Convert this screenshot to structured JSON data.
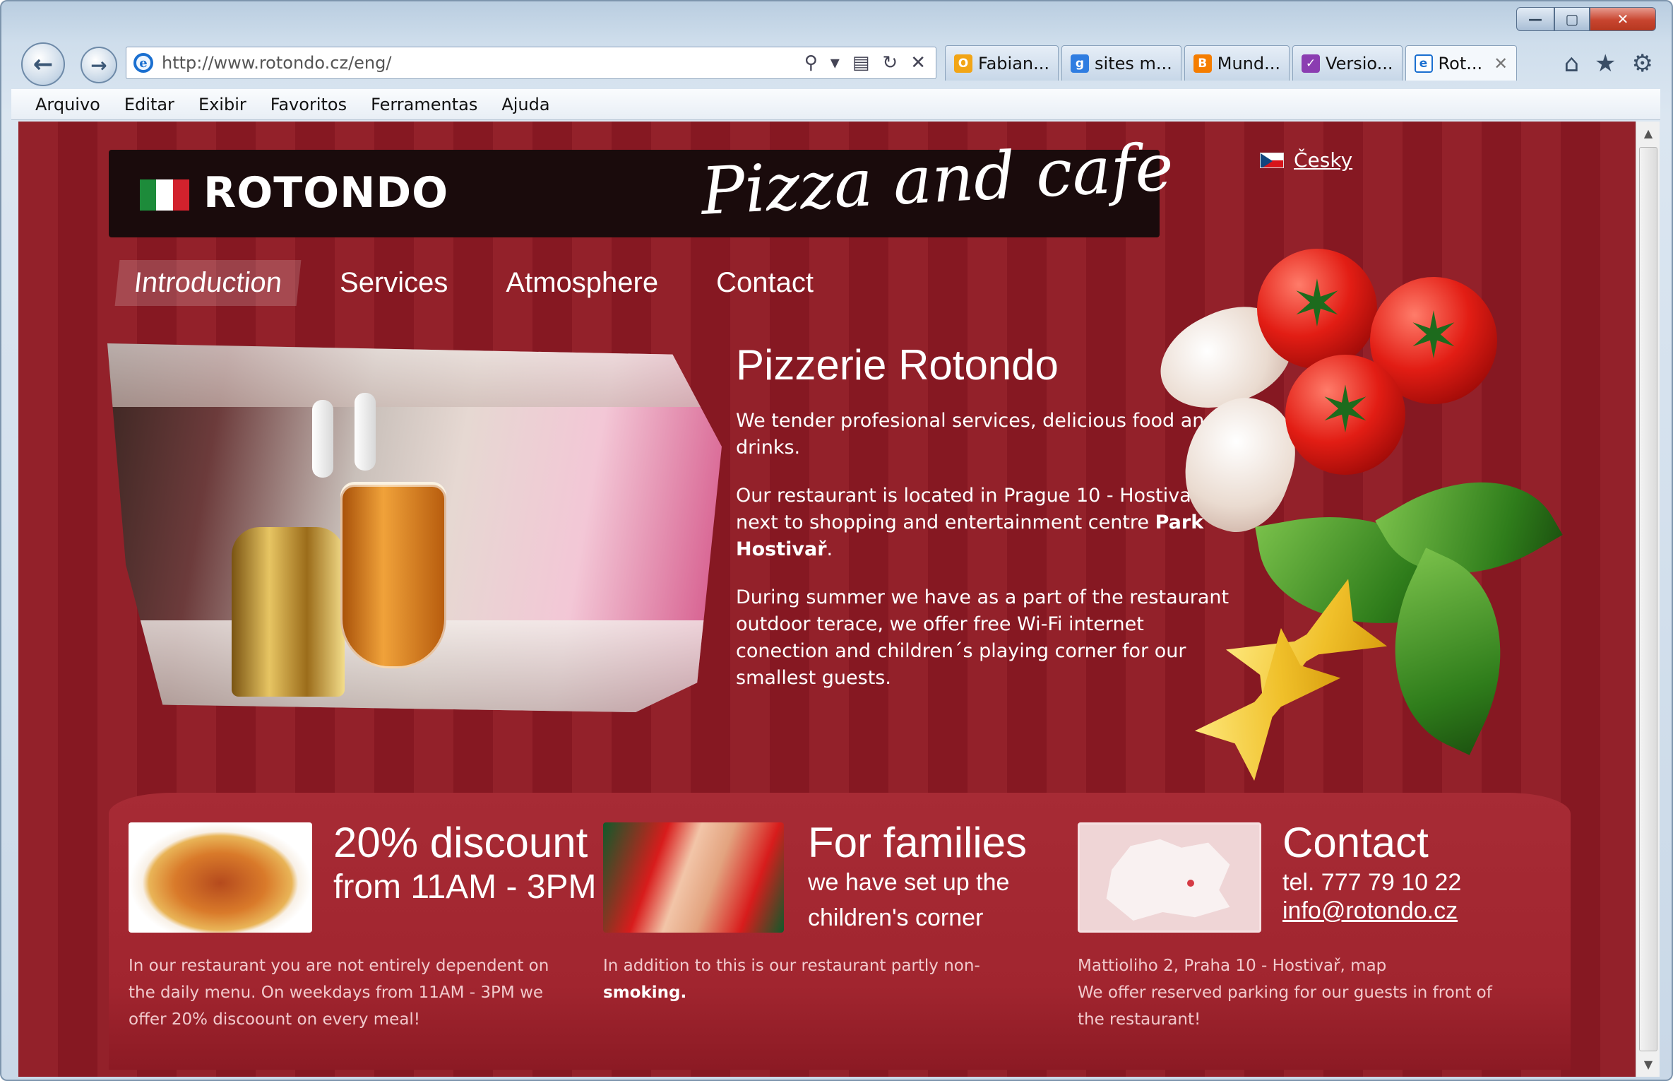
{
  "browser": {
    "url": "http://www.rotondo.cz/eng/",
    "tabs": [
      {
        "label": "Fabian...",
        "icon": "outlook-icon",
        "color": "#f2a516"
      },
      {
        "label": "sites m...",
        "icon": "google-icon",
        "color": "#2f7de1"
      },
      {
        "label": "Mund...",
        "icon": "blogger-icon",
        "color": "#f57d00"
      },
      {
        "label": "Versio...",
        "icon": "checkbox-icon",
        "color": "#8b3db1"
      },
      {
        "label": "Rot...",
        "icon": "ie-icon",
        "color": "#1a6fd0"
      }
    ],
    "menu": [
      "Arquivo",
      "Editar",
      "Exibir",
      "Favoritos",
      "Ferramentas",
      "Ajuda"
    ]
  },
  "site": {
    "brand": "ROTONDO",
    "tagline": "Pizza and cafe",
    "language_link": "Česky",
    "nav": [
      "Introduction",
      "Services",
      "Atmosphere",
      "Contact"
    ],
    "intro": {
      "title": "Pizzerie Rotondo",
      "p1": "We tender profesional services, delicious food and drinks.",
      "p2_start": "Our restaurant is located in Prague 10 - Hostivař, next to shopping and entertainment centre ",
      "p2_bold": "Park Hostivař",
      "p2_end": ".",
      "p3": "During summer we have as a part of the restaurant outdoor terace, we offer free Wi-Fi internet conection and children´s playing corner for our smallest guests."
    },
    "promos": {
      "discount": {
        "title": "20% discount",
        "subtitle": "from 11AM - 3PM",
        "text": "In our restaurant you are not entirely dependent on the daily menu. On weekdays from 11AM - 3PM we offer 20% discoount on every meal!"
      },
      "families": {
        "title": "For families",
        "subtitle1": "we have set up the",
        "subtitle2": "children's corner",
        "text_start": "In addition to this is our restaurant partly non-",
        "text_bold": "smoking",
        "text_end": "."
      },
      "contact": {
        "title": "Contact",
        "tel": "tel. 777 79 10 22",
        "email": "info@rotondo.cz",
        "address": "Mattioliho 2, Praha 10 - Hostivař, map",
        "parking": "We offer reserved parking for our guests in front of the restaurant!"
      }
    }
  }
}
